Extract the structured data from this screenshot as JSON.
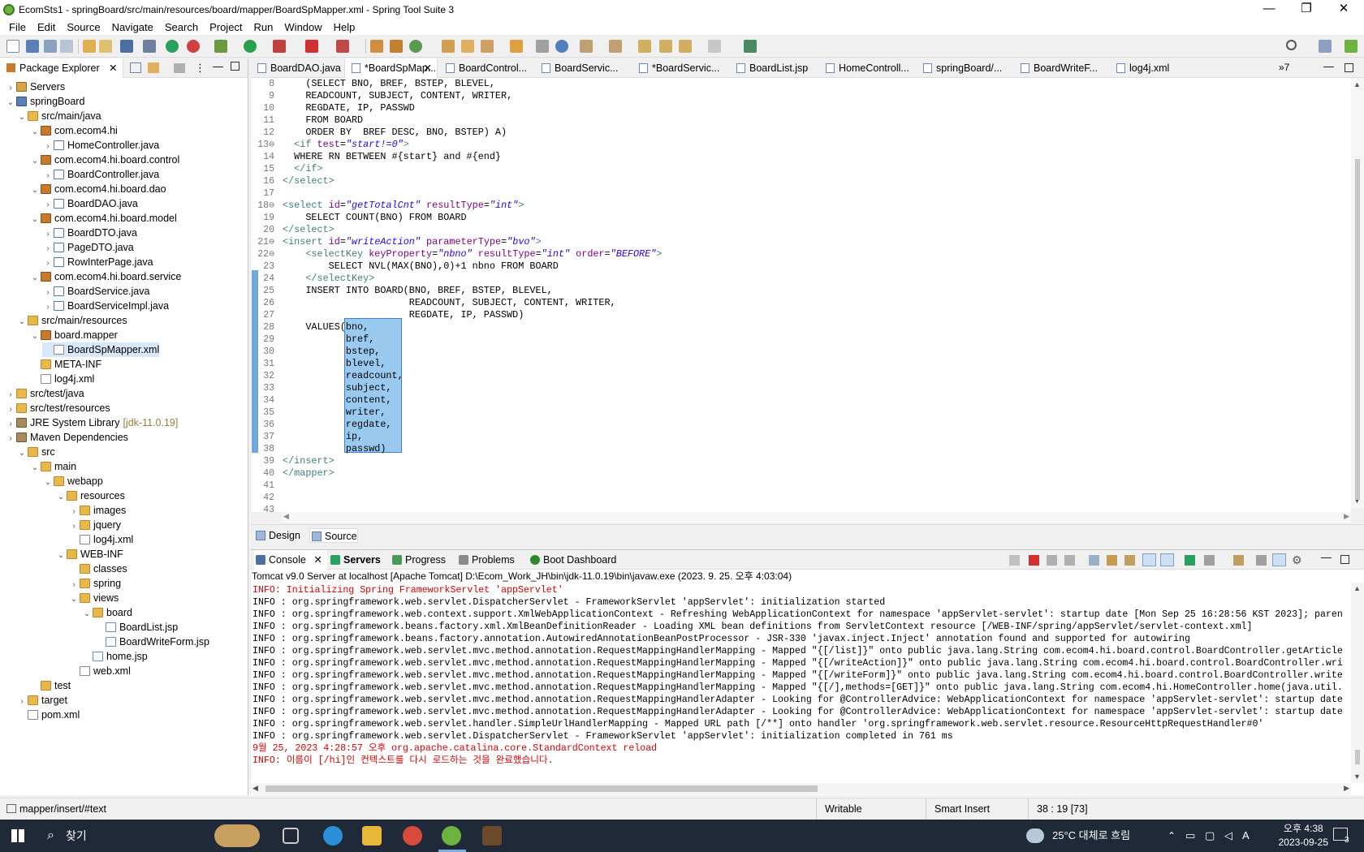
{
  "window": {
    "title": "EcomSts1 - springBoard/src/main/resources/board/mapper/BoardSpMapper.xml - Spring Tool Suite 3",
    "minimize": "—",
    "maximize": "❐",
    "close": "✕"
  },
  "menu": [
    "File",
    "Edit",
    "Source",
    "Navigate",
    "Search",
    "Project",
    "Run",
    "Window",
    "Help"
  ],
  "package_explorer": {
    "tab_label": "Package Explorer",
    "tree": [
      {
        "label": "Servers",
        "icon": "server-folder-icon",
        "expanded": false
      },
      {
        "label": "springBoard",
        "icon": "project-icon",
        "expanded": true
      },
      {
        "label": "src/main/java",
        "icon": "source-folder-icon",
        "expanded": true
      },
      {
        "label": "com.ecom4.hi",
        "icon": "package-icon",
        "expanded": true
      },
      {
        "label": "HomeController.java",
        "icon": "java-file-icon",
        "expanded": false
      },
      {
        "label": "com.ecom4.hi.board.control",
        "icon": "package-icon",
        "expanded": true
      },
      {
        "label": "BoardController.java",
        "icon": "java-file-icon",
        "expanded": false
      },
      {
        "label": "com.ecom4.hi.board.dao",
        "icon": "package-icon",
        "expanded": true
      },
      {
        "label": "BoardDAO.java",
        "icon": "java-file-icon",
        "expanded": false
      },
      {
        "label": "com.ecom4.hi.board.model",
        "icon": "package-icon",
        "expanded": true
      },
      {
        "label": "BoardDTO.java",
        "icon": "java-file-icon",
        "expanded": false
      },
      {
        "label": "PageDTO.java",
        "icon": "java-file-icon",
        "expanded": false
      },
      {
        "label": "RowInterPage.java",
        "icon": "java-interface-icon",
        "expanded": false
      },
      {
        "label": "com.ecom4.hi.board.service",
        "icon": "package-icon",
        "expanded": true
      },
      {
        "label": "BoardService.java",
        "icon": "java-interface-icon",
        "expanded": false
      },
      {
        "label": "BoardServiceImpl.java",
        "icon": "java-file-icon",
        "expanded": false
      },
      {
        "label": "src/main/resources",
        "icon": "source-folder-icon",
        "expanded": true
      },
      {
        "label": "board.mapper",
        "icon": "package-icon",
        "expanded": true
      },
      {
        "label": "BoardSpMapper.xml",
        "icon": "xml-file-icon",
        "selected": true
      },
      {
        "label": "META-INF",
        "icon": "folder-icon"
      },
      {
        "label": "log4j.xml",
        "icon": "xml-file-icon"
      },
      {
        "label": "src/test/java",
        "icon": "source-folder-icon",
        "expanded": false
      },
      {
        "label": "src/test/resources",
        "icon": "source-folder-icon",
        "expanded": false
      },
      {
        "label": "JRE System Library",
        "suffix": "[jdk-11.0.19]",
        "icon": "library-icon",
        "expanded": false
      },
      {
        "label": "Maven Dependencies",
        "icon": "library-icon",
        "expanded": false
      },
      {
        "label": "src",
        "icon": "folder-icon",
        "expanded": true
      },
      {
        "label": "main",
        "icon": "folder-icon",
        "expanded": true
      },
      {
        "label": "webapp",
        "icon": "folder-icon",
        "expanded": true
      },
      {
        "label": "resources",
        "icon": "folder-icon",
        "expanded": true
      },
      {
        "label": "images",
        "icon": "folder-icon",
        "expanded": false
      },
      {
        "label": "jquery",
        "icon": "folder-icon",
        "expanded": false
      },
      {
        "label": "log4j.xml",
        "icon": "xml-file-icon"
      },
      {
        "label": "WEB-INF",
        "icon": "folder-icon",
        "expanded": true
      },
      {
        "label": "classes",
        "icon": "folder-icon"
      },
      {
        "label": "spring",
        "icon": "folder-icon",
        "expanded": false
      },
      {
        "label": "views",
        "icon": "folder-icon",
        "expanded": true
      },
      {
        "label": "board",
        "icon": "folder-icon",
        "expanded": true
      },
      {
        "label": "BoardList.jsp",
        "icon": "jsp-file-icon"
      },
      {
        "label": "BoardWriteForm.jsp",
        "icon": "jsp-file-icon"
      },
      {
        "label": "home.jsp",
        "icon": "jsp-file-icon"
      },
      {
        "label": "web.xml",
        "icon": "xml-file-icon"
      },
      {
        "label": "test",
        "icon": "folder-icon"
      },
      {
        "label": "target",
        "icon": "folder-icon",
        "expanded": false
      },
      {
        "label": "pom.xml",
        "icon": "maven-pom-icon"
      }
    ]
  },
  "editor_tabs": [
    {
      "label": "BoardDAO.java"
    },
    {
      "label": "*BoardSpMap...",
      "active": true
    },
    {
      "label": "BoardControl..."
    },
    {
      "label": "BoardServic..."
    },
    {
      "label": "*BoardServic..."
    },
    {
      "label": "BoardList.jsp"
    },
    {
      "label": "HomeControll..."
    },
    {
      "label": "springBoard/..."
    },
    {
      "label": "BoardWriteF..."
    },
    {
      "label": "log4j.xml"
    }
  ],
  "editor_overflow": "»7",
  "code_lines": [
    {
      "n": "8",
      "text": "    (SELECT BNO, BREF, BSTEP, BLEVEL,"
    },
    {
      "n": "9",
      "text": "    READCOUNT, SUBJECT, CONTENT, WRITER,"
    },
    {
      "n": "10",
      "text": "    REGDATE, IP, PASSWD"
    },
    {
      "n": "11",
      "text": "    FROM BOARD"
    },
    {
      "n": "12",
      "text": "    ORDER BY  BREF DESC, BNO, BSTEP) A)"
    },
    {
      "n": "13⊖",
      "text": "  <if test=\"start!=0\">"
    },
    {
      "n": "14",
      "text": "  WHERE RN BETWEEN #{start} and #{end}"
    },
    {
      "n": "15",
      "text": "  </if>"
    },
    {
      "n": "16",
      "text": "</select>"
    },
    {
      "n": "17",
      "text": ""
    },
    {
      "n": "18⊖",
      "text": "<select id=\"getTotalCnt\" resultType=\"int\">"
    },
    {
      "n": "19",
      "text": "    SELECT COUNT(BNO) FROM BOARD"
    },
    {
      "n": "20",
      "text": "</select>"
    },
    {
      "n": "21⊖",
      "text": "<insert id=\"writeAction\" parameterType=\"bvo\">"
    },
    {
      "n": "22⊖",
      "text": "    <selectKey keyProperty=\"nbno\" resultType=\"int\" order=\"BEFORE\">"
    },
    {
      "n": "23",
      "text": "        SELECT NVL(MAX(BNO),0)+1 nbno FROM BOARD"
    },
    {
      "n": "24",
      "text": "    </selectKey>"
    },
    {
      "n": "25",
      "text": "    INSERT INTO BOARD(BNO, BREF, BSTEP, BLEVEL,"
    },
    {
      "n": "26",
      "text": "                      READCOUNT, SUBJECT, CONTENT, WRITER,"
    },
    {
      "n": "27",
      "text": "                      REGDATE, IP, PASSWD)"
    },
    {
      "n": "28",
      "text": "    VALUES(bno,"
    },
    {
      "n": "29",
      "text": "           bref,"
    },
    {
      "n": "30",
      "text": "           bstep,"
    },
    {
      "n": "31",
      "text": "           blevel,"
    },
    {
      "n": "32",
      "text": "           readcount,"
    },
    {
      "n": "33",
      "text": "           subject,"
    },
    {
      "n": "34",
      "text": "           content,"
    },
    {
      "n": "35",
      "text": "           writer,"
    },
    {
      "n": "36",
      "text": "           regdate,"
    },
    {
      "n": "37",
      "text": "           ip,"
    },
    {
      "n": "38",
      "text": "           passwd)"
    },
    {
      "n": "39",
      "text": "</insert>"
    },
    {
      "n": "40",
      "text": "</mapper>"
    },
    {
      "n": "41",
      "text": ""
    },
    {
      "n": "42",
      "text": ""
    },
    {
      "n": "43",
      "text": ""
    }
  ],
  "editor_bottom_tabs": [
    "Design",
    "Source"
  ],
  "console": {
    "tabs": [
      "Console",
      "Servers",
      "Progress",
      "Problems",
      "Boot Dashboard"
    ],
    "description": "Tomcat v9.0 Server at localhost [Apache Tomcat] D:\\Ecom_Work_JH\\bin\\jdk-11.0.19\\bin\\javaw.exe  (2023. 9. 25. 오후 4:03:04)",
    "lines": [
      {
        "text": "INFO: Initializing Spring FrameworkServlet 'appServlet'",
        "red": true
      },
      {
        "text": "INFO : org.springframework.web.servlet.DispatcherServlet - FrameworkServlet 'appServlet': initialization started",
        "red": false
      },
      {
        "text": "INFO : org.springframework.web.context.support.XmlWebApplicationContext - Refreshing WebApplicationContext for namespace 'appServlet-servlet': startup date [Mon Sep 25 16:28:56 KST 2023]; paren",
        "red": false
      },
      {
        "text": "INFO : org.springframework.beans.factory.xml.XmlBeanDefinitionReader - Loading XML bean definitions from ServletContext resource [/WEB-INF/spring/appServlet/servlet-context.xml]",
        "red": false
      },
      {
        "text": "INFO : org.springframework.beans.factory.annotation.AutowiredAnnotationBeanPostProcessor - JSR-330 'javax.inject.Inject' annotation found and supported for autowiring",
        "red": false
      },
      {
        "text": "INFO : org.springframework.web.servlet.mvc.method.annotation.RequestMappingHandlerMapping - Mapped \"{[/list]}\" onto public java.lang.String com.ecom4.hi.board.control.BoardController.getArticle",
        "red": false
      },
      {
        "text": "INFO : org.springframework.web.servlet.mvc.method.annotation.RequestMappingHandlerMapping - Mapped \"{[/writeAction]}\" onto public java.lang.String com.ecom4.hi.board.control.BoardController.wri",
        "red": false
      },
      {
        "text": "INFO : org.springframework.web.servlet.mvc.method.annotation.RequestMappingHandlerMapping - Mapped \"{[/writeForm]}\" onto public java.lang.String com.ecom4.hi.board.control.BoardController.write",
        "red": false
      },
      {
        "text": "INFO : org.springframework.web.servlet.mvc.method.annotation.RequestMappingHandlerMapping - Mapped \"{[/],methods=[GET]}\" onto public java.lang.String com.ecom4.hi.HomeController.home(java.util.",
        "red": false
      },
      {
        "text": "INFO : org.springframework.web.servlet.mvc.method.annotation.RequestMappingHandlerAdapter - Looking for @ControllerAdvice: WebApplicationContext for namespace 'appServlet-servlet': startup date",
        "red": false
      },
      {
        "text": "INFO : org.springframework.web.servlet.mvc.method.annotation.RequestMappingHandlerAdapter - Looking for @ControllerAdvice: WebApplicationContext for namespace 'appServlet-servlet': startup date",
        "red": false
      },
      {
        "text": "INFO : org.springframework.web.servlet.handler.SimpleUrlHandlerMapping - Mapped URL path [/**] onto handler 'org.springframework.web.servlet.resource.ResourceHttpRequestHandler#0'",
        "red": false
      },
      {
        "text": "INFO : org.springframework.web.servlet.DispatcherServlet - FrameworkServlet 'appServlet': initialization completed in 761 ms",
        "red": false
      },
      {
        "text": "9월 25, 2023 4:28:57 오후 org.apache.catalina.core.StandardContext reload",
        "red": true
      },
      {
        "text": "INFO: 이름이 [/hi]인 컨텍스트를 다시 로드하는 것을 완료했습니다.",
        "red": true
      }
    ]
  },
  "status_bar": {
    "path": "mapper/insert/#text",
    "writable": "Writable",
    "insert_mode": "Smart Insert",
    "position": "38 : 19 [73]"
  },
  "taskbar": {
    "search_placeholder": "찾기",
    "weather": "25°C  대체로 흐림",
    "ime": "A",
    "time": "오후 4:38",
    "date": "2023-09-25",
    "notifications": "3"
  },
  "colors": {
    "accent": "#3a7fd0",
    "selection": "#99c9ef",
    "tag": "#3f7f7f",
    "attr": "#7f007f",
    "string": "#2a00ff",
    "console_red": "#e00000"
  }
}
